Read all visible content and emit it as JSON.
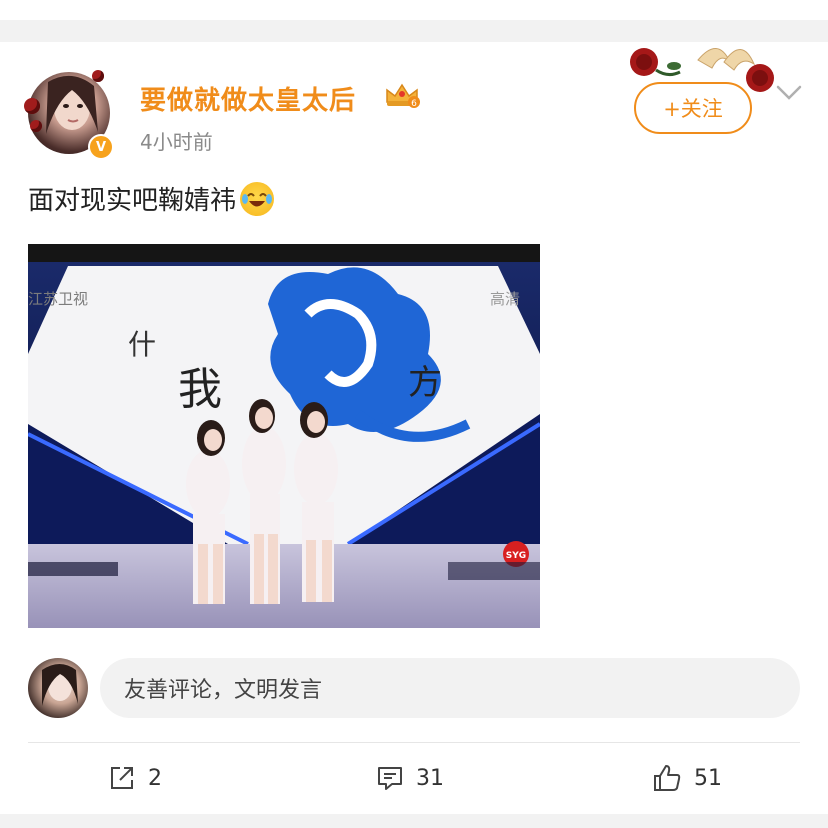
{
  "post": {
    "username": "要做就做太皇太后",
    "timestamp": "4小时前",
    "follow_label": "+关注",
    "text": "面对现实吧鞠婧祎",
    "media": {
      "corner_left": "江苏卫视",
      "corner_right": "高清",
      "bottom_logo": "SYG"
    }
  },
  "comment": {
    "placeholder": "友善评论，文明发言"
  },
  "actions": {
    "share_count": "2",
    "comment_count": "31",
    "like_count": "51"
  },
  "colors": {
    "accent": "#f08c1a",
    "text": "#222222",
    "muted": "#8a8a8a",
    "background": "#f2f2f2"
  },
  "icons": [
    "verified-badge-icon",
    "crown-badge-icon",
    "rose-decoration-icon",
    "chevron-down-icon",
    "laugh-cry-emoji-icon",
    "share-icon",
    "comment-icon",
    "like-icon"
  ]
}
